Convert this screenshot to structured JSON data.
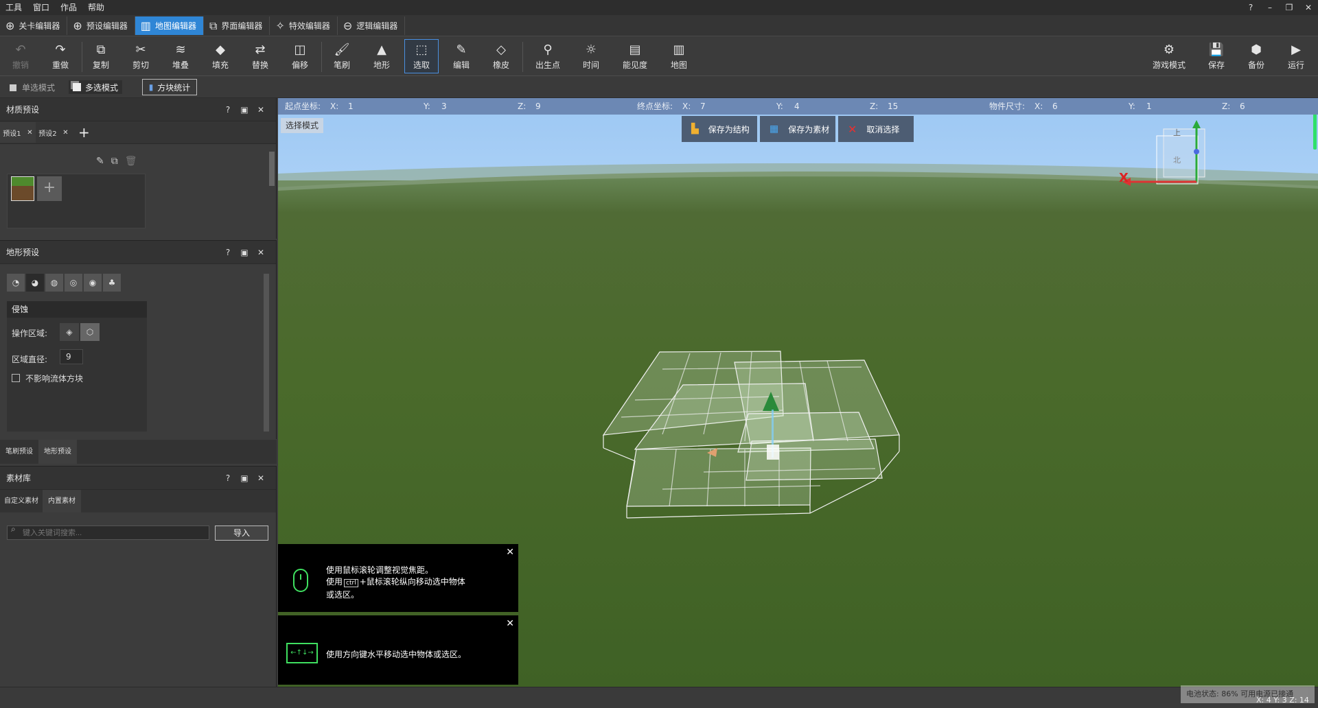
{
  "menu": {
    "items": [
      "工具",
      "窗口",
      "作品",
      "帮助"
    ],
    "window_controls": [
      "?",
      "–",
      "❐",
      "✕"
    ]
  },
  "editor_tabs": [
    {
      "label": "关卡编辑器",
      "icon": "crosshair-icon"
    },
    {
      "label": "预设编辑器",
      "icon": "crosshair-icon"
    },
    {
      "label": "地图编辑器",
      "icon": "map-icon",
      "active": true
    },
    {
      "label": "界面编辑器",
      "icon": "window-icon"
    },
    {
      "label": "特效编辑器",
      "icon": "sparkle-icon"
    },
    {
      "label": "逻辑编辑器",
      "icon": "logic-icon"
    }
  ],
  "toolbar": {
    "undo": "撤销",
    "redo": "重做",
    "copy": "复制",
    "cut": "剪切",
    "stack": "堆叠",
    "fill": "填充",
    "replace": "替换",
    "offset": "偏移",
    "brush": "笔刷",
    "terrain": "地形",
    "select": "选取",
    "edit": "编辑",
    "eraser": "橡皮",
    "spawn": "出生点",
    "time": "时间",
    "visibility": "能见度",
    "map": "地图",
    "game_mode": "游戏模式",
    "save": "保存",
    "backup": "备份",
    "run": "运行"
  },
  "modebar": {
    "single": "单选模式",
    "multi": "多选模式",
    "stats": "方块统计"
  },
  "material_panel": {
    "title": "材质预设",
    "tabs": [
      "预设1",
      "预设2"
    ],
    "add": "+"
  },
  "terrain_panel": {
    "title": "地形预设",
    "section": "侵蚀",
    "area_label": "操作区域:",
    "diameter_label": "区域直径:",
    "diameter_value": "9",
    "checkbox_label": "不影响流体方块"
  },
  "preset_tabs": [
    "笔刷预设",
    "地形预设"
  ],
  "asset_panel": {
    "title": "素材库",
    "tabs": [
      "自定义素材",
      "内置素材"
    ],
    "search_placeholder": "键入关键词搜索...",
    "import": "导入"
  },
  "coords": {
    "start_label": "起点坐标:",
    "start": {
      "x": "1",
      "y": "3",
      "z": "9"
    },
    "end_label": "终点坐标:",
    "end": {
      "x": "7",
      "y": "4",
      "z": "15"
    },
    "size_label": "物件尺寸:",
    "size": {
      "x": "6",
      "y": "1",
      "z": "6"
    },
    "x_label": "X:",
    "y_label": "Y:",
    "z_label": "Z:"
  },
  "viewport": {
    "mode_badge": "选择模式",
    "save_structure": "保存为结构",
    "save_asset": "保存为素材",
    "cancel_select": "取消选择",
    "gizmo": {
      "y": "Y",
      "x": "X",
      "top": "上",
      "north": "北"
    }
  },
  "hints": [
    {
      "line1": "使用鼠标滚轮调整视觉焦距。",
      "line2a": "使用",
      "key": "ctrl",
      "line2b": "+鼠标滚轮纵向移动选中物体",
      "line3": "或选区。"
    },
    {
      "line1": "使用方向键水平移动选中物体或选区。"
    }
  ],
  "status": {
    "battery": "电池状态: 86% 可用电源已接通",
    "xyz": "X: 4  Y: 3  Z: 14"
  }
}
